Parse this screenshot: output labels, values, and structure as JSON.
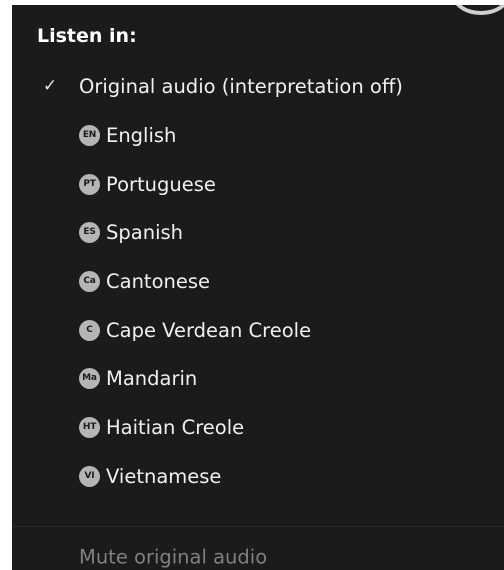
{
  "menu": {
    "heading": "Listen in:",
    "original_item": {
      "check_glyph": "✓",
      "label": "Original audio (interpretation off)",
      "checked": true
    },
    "languages": [
      {
        "badge": "EN",
        "label": "English",
        "icon": "english-badge-icon"
      },
      {
        "badge": "PT",
        "label": "Portuguese",
        "icon": "portuguese-badge-icon"
      },
      {
        "badge": "ES",
        "label": "Spanish",
        "icon": "spanish-badge-icon"
      },
      {
        "badge": "Ca",
        "label": "Cantonese",
        "icon": "cantonese-badge-icon"
      },
      {
        "badge": "C",
        "label": "Cape Verdean Creole",
        "icon": "cape-verdean-creole-badge-icon"
      },
      {
        "badge": "Ma",
        "label": "Mandarin",
        "icon": "mandarin-badge-icon"
      },
      {
        "badge": "HT",
        "label": "Haitian Creole",
        "icon": "haitian-creole-badge-icon"
      },
      {
        "badge": "VI",
        "label": "Vietnamese",
        "icon": "vietnamese-badge-icon"
      }
    ],
    "mute_label": "Mute original audio"
  },
  "colors": {
    "menu_background": "#1b1b1b",
    "text": "#f0f0f0",
    "badge_background": "#b5b5b5",
    "disabled_text": "#808080"
  }
}
